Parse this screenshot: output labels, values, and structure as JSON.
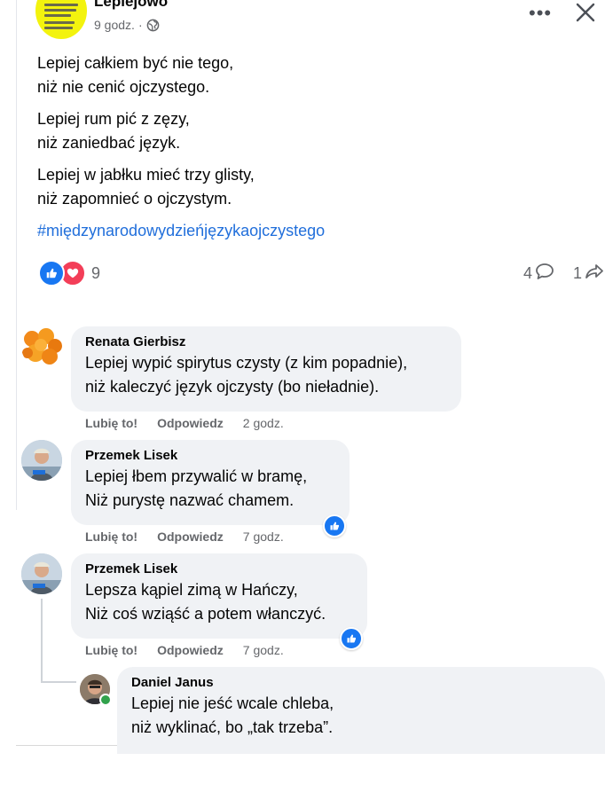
{
  "post": {
    "page_name": "Lepiejowo",
    "time": "9 godz.",
    "separator": "·",
    "more_label": "•••",
    "stanzas": [
      [
        "Lepiej całkiem być nie tego,",
        "niż nie cenić ojczystego."
      ],
      [
        "Lepiej rum pić z zęzy,",
        "niż zaniedbać język."
      ],
      [
        "Lepiej w jabłku mieć trzy glisty,",
        "niż zapomnieć o ojczystym."
      ]
    ],
    "hashtag": "#międzynarodowydzieńjęzykaojczystego",
    "reaction_count": "9",
    "comment_count": "4",
    "share_count": "1"
  },
  "actions": {
    "like": "Lubię to!",
    "reply": "Odpowiedz"
  },
  "comments": [
    {
      "author": "Renata Gierbisz",
      "lines": [
        "Lepiej wypić spirytus czysty (z kim popadnie),",
        "niż kaleczyć język ojczysty (bo nieładnie)."
      ],
      "time": "2 godz."
    },
    {
      "author": "Przemek Lisek",
      "lines": [
        "Lepiej łbem przywalić w bramę,",
        "Niż purystę nazwać chamem."
      ],
      "time": "7 godz."
    },
    {
      "author": "Przemek Lisek",
      "lines": [
        "Lepsza kąpiel zimą w Hańczy,",
        "Niż coś wziąść a potem włanczyć."
      ],
      "time": "7 godz."
    },
    {
      "author": "Daniel Janus",
      "lines": [
        "Lepiej nie jeść wcale chleba,",
        "niż wyklinać, bo „tak trzeba”."
      ]
    }
  ],
  "colors": {
    "accent": "#1877f2",
    "hashtag": "#216fdb",
    "love": "#f33e58",
    "bubble": "#f0f2f5",
    "muted": "#65676b",
    "online": "#31a24c"
  },
  "icons": {
    "privacy": "globe-icon",
    "close": "close-icon",
    "comment": "comment-icon",
    "share": "share-icon",
    "like": "like-icon",
    "love": "love-icon"
  }
}
